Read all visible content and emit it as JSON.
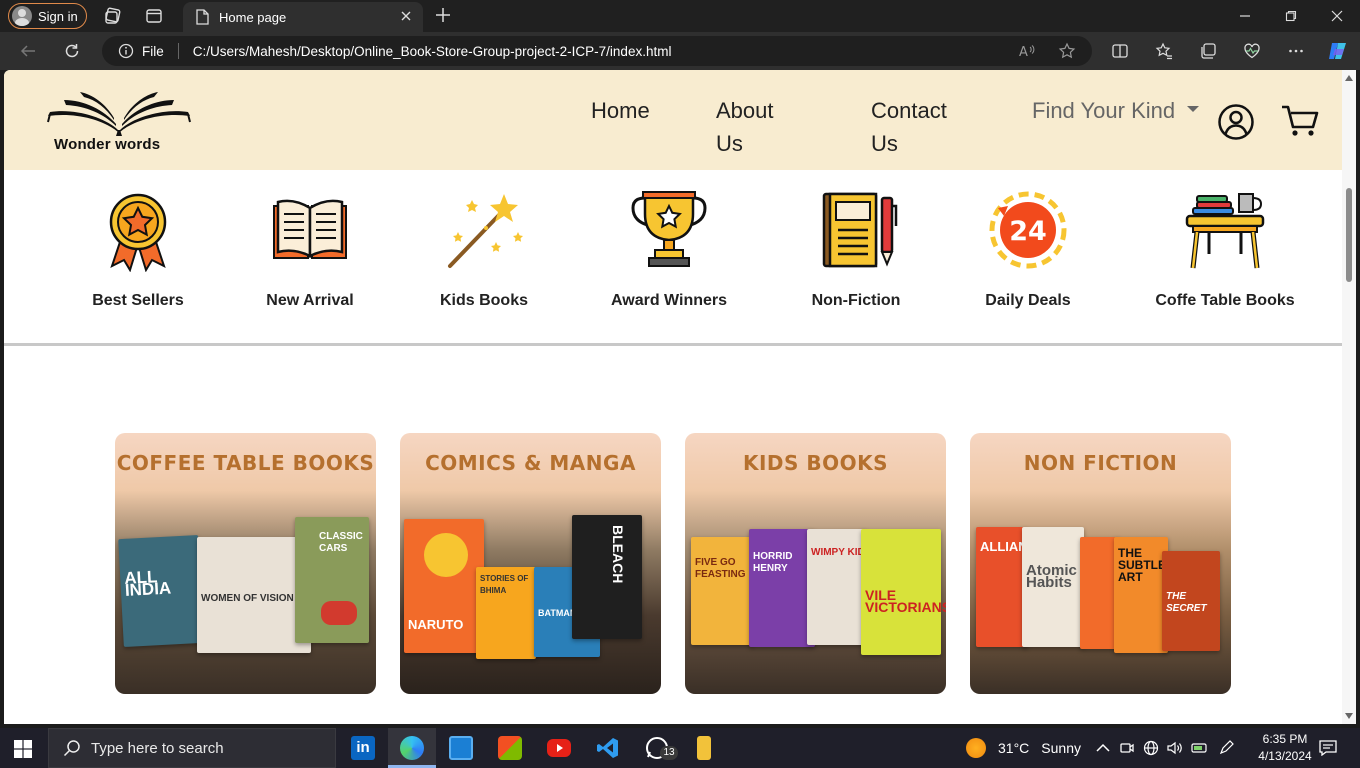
{
  "browser": {
    "signin_label": "Sign in",
    "tab_title": "Home page",
    "url_file_label": "File",
    "url": "C:/Users/Mahesh/Desktop/Online_Book-Store-Group-project-2-ICP-7/index.html"
  },
  "site": {
    "brand": "Wonder words",
    "nav": {
      "home": "Home",
      "about_line1": "About",
      "about_line2": "Us",
      "contact_line1": "Contact",
      "contact_line2": "Us",
      "find": "Find Your Kind"
    },
    "categories": [
      {
        "label": "Best Sellers",
        "icon": "ribbon-medal-icon"
      },
      {
        "label": "New Arrival",
        "icon": "open-book-icon"
      },
      {
        "label": "Kids Books",
        "icon": "magic-wand-icon"
      },
      {
        "label": "Award Winners",
        "icon": "trophy-icon"
      },
      {
        "label": "Non-Fiction",
        "icon": "notebook-pen-icon"
      },
      {
        "label": "Daily Deals",
        "icon": "24-hours-icon"
      },
      {
        "label": "Coffe Table Books",
        "icon": "coffee-table-icon"
      }
    ],
    "cards": [
      {
        "title": "COFFEE TABLE BOOKS",
        "books": [
          "ALL INDIA",
          "WOMEN OF VISION",
          "CLASSIC CARS"
        ]
      },
      {
        "title": "COMICS & MANGA",
        "books": [
          "NARUTO",
          "STORIES OF BHIMA",
          "BATMAN"
        ]
      },
      {
        "title": "KIDS BOOKS",
        "books": [
          "FIVE GO FEASTING",
          "HORRID HENRY",
          "WIMPY KID",
          "VILE VICTORIANS"
        ]
      },
      {
        "title": "NON FICTION",
        "books": [
          "ALLIANCE",
          "Atomic Habits",
          "THE SUBTLE ART",
          "THE SECRET"
        ]
      }
    ]
  },
  "taskbar": {
    "search_placeholder": "Type here to search",
    "whatsapp_badge": "13",
    "weather_temp": "31°C",
    "weather_desc": "Sunny",
    "time": "6:35 PM",
    "date": "4/13/2024"
  },
  "colors": {
    "header_bg": "#f8ecd0",
    "card_title": "#b5702e",
    "signin_border": "#e08a4a"
  }
}
